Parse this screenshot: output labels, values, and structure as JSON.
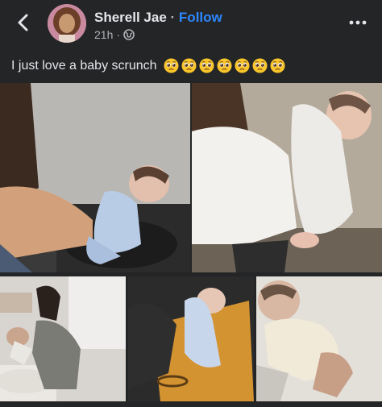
{
  "post": {
    "author_name": "Sherell Jae",
    "separator": "·",
    "follow_label": "Follow",
    "time": "21h",
    "meta_separator": "·",
    "caption": "I just love a baby scrunch"
  },
  "icons": {
    "back": "back-arrow-icon",
    "audience": "globe-icon",
    "more": "more-options-icon",
    "emoji": "pleading-face-emoji"
  },
  "emoji_count": 7,
  "colors": {
    "background": "#242526",
    "text_primary": "#e4e6eb",
    "text_secondary": "#b0b3b8",
    "link": "#2d88ff"
  }
}
